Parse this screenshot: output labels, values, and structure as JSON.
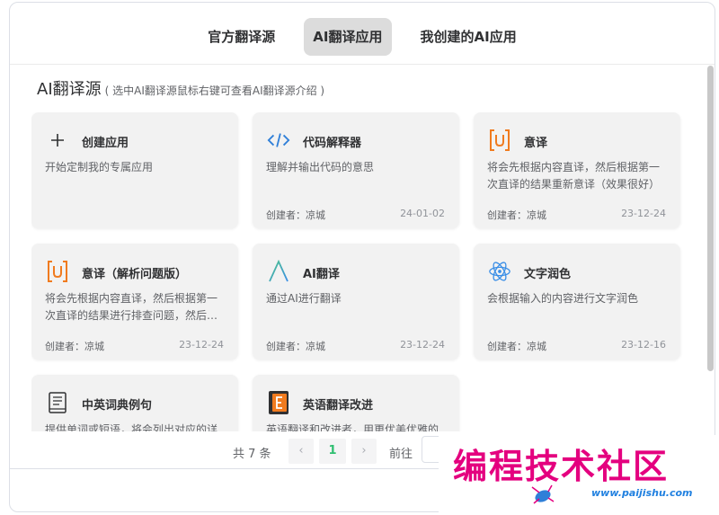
{
  "tabs": [
    {
      "label": "官方翻译源",
      "active": false
    },
    {
      "label": "AI翻译应用",
      "active": true
    },
    {
      "label": "我创建的AI应用",
      "active": false
    }
  ],
  "section": {
    "title": "AI翻译源",
    "hint": "( 选中AI翻译源鼠标右键可查看AI翻译源介绍 )"
  },
  "cards": [
    {
      "icon": "plus-icon",
      "name": "创建应用",
      "desc": "开始定制我的专属应用",
      "creator": "",
      "date": ""
    },
    {
      "icon": "code-icon",
      "name": "代码解释器",
      "desc": "理解并输出代码的意思",
      "creator": "创建者：凉城",
      "date": "24-01-02"
    },
    {
      "icon": "bracket-u-icon",
      "name": "意译",
      "desc": "将会先根据内容直译，然后根据第一次直译的结果重新意译（效果很好）",
      "creator": "创建者：凉城",
      "date": "23-12-24"
    },
    {
      "icon": "bracket-u-icon",
      "name": "意译（解析问题版）",
      "desc": "将会先根据内容直译，然后根据第一次直译的结果进行排查问题，然后…",
      "creator": "创建者：凉城",
      "date": "23-12-24"
    },
    {
      "icon": "ai-caret-icon",
      "name": "AI翻译",
      "desc": "通过AI进行翻译",
      "creator": "创建者：凉城",
      "date": "23-12-24"
    },
    {
      "icon": "atom-icon",
      "name": "文字润色",
      "desc": "会根据输入的内容进行文字润色",
      "creator": "创建者：凉城",
      "date": "23-12-16"
    },
    {
      "icon": "book-icon",
      "name": "中英词典例句",
      "desc": "提供单词或短语，将会列出对应的详细释义和例句",
      "creator": "",
      "date": ""
    },
    {
      "icon": "letter-e-icon",
      "name": "英语翻译改进",
      "desc": "英语翻译和改进者，用更优美优雅的高级英语单词和句子替换",
      "creator": "",
      "date": ""
    }
  ],
  "pagination": {
    "total": "共 7 条",
    "prev": "‹",
    "current": "1",
    "next": "›",
    "goto": "前往"
  },
  "watermark": {
    "title": "编程技术社区",
    "url": "www.paijishu.com"
  },
  "colors": {
    "active_tab": "#dcdcdc",
    "card_bg": "#f2f2f2",
    "page_active": "#2fbf71",
    "orange": "#f07b1f",
    "blue": "#2f7fd8",
    "watermark": "#e4007f"
  }
}
